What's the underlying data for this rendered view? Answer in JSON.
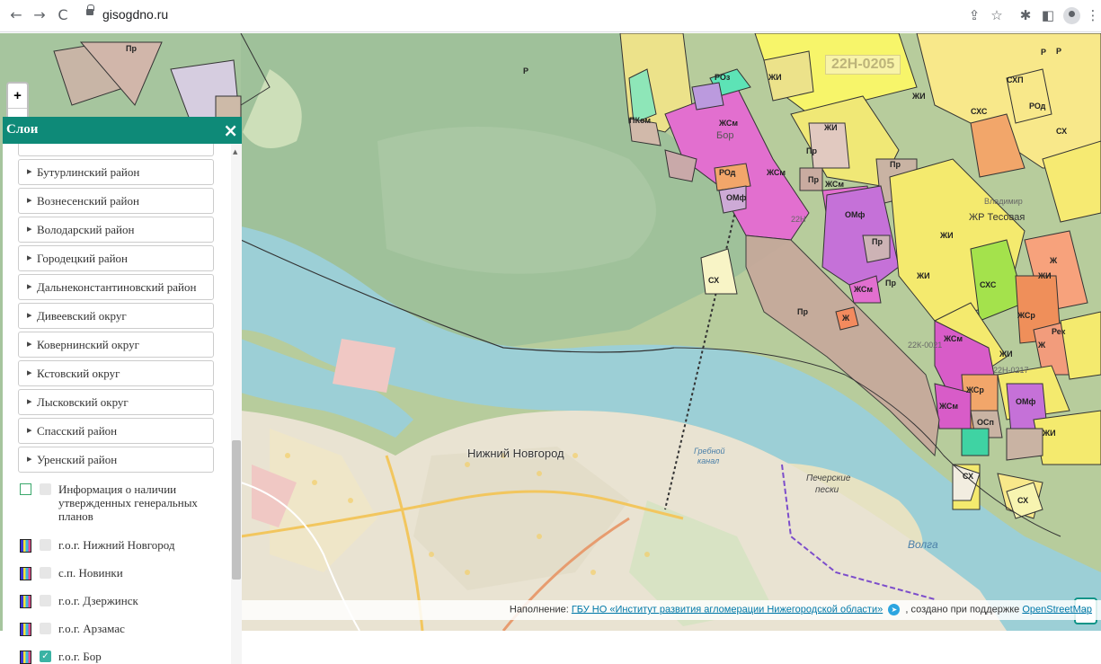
{
  "browser": {
    "url": "gisogdno.ru",
    "back": "←",
    "forward": "→",
    "reload": "C"
  },
  "map": {
    "zoom_in": "+",
    "zoom_out": "-",
    "chat_icon": "chat-icon",
    "attribution": {
      "prefix": "Наполнение:",
      "link": "ГБУ НО «Институт развития агломерации Нижегородской области»",
      "middle": ", создано при поддержке",
      "osm": "OpenStreetMap"
    },
    "labels": {
      "city": "Нижний Новгород",
      "pecherskie": "Печерские",
      "peski": "пески",
      "volga": "Волга",
      "grebnoy": "Гребной",
      "kanal": "канал",
      "bor": "Бор",
      "zr_tesovaya": "ЖР Тесовая",
      "road": "22Н-0205"
    },
    "zones": [
      "Пр",
      "ПКом",
      "Р",
      "ЖИ",
      "ЖСм",
      "РОз",
      "РОд",
      "ОМф",
      "СХ",
      "СХП",
      "СХС",
      "Ж",
      "ЖСр",
      "ОСп",
      "Рек"
    ]
  },
  "layers": {
    "title": "Слои",
    "close": "×",
    "districts": [
      "Бутурлинский район",
      "Вознесенский район",
      "Володарский район",
      "Городецкий район",
      "Дальнеконстантиновский район",
      "Дивеевский округ",
      "Ковернинский округ",
      "Кстовский округ",
      "Лысковский округ",
      "Спасский район",
      "Уренский район"
    ],
    "info": "Информация о наличии утвержденных генеральных планов",
    "plans": [
      {
        "label": "г.о.г. Нижний Новгород",
        "checked": false
      },
      {
        "label": "с.п. Новинки",
        "checked": false
      },
      {
        "label": "г.о.г. Дзержинск",
        "checked": false
      },
      {
        "label": "г.о.г. Арзамас",
        "checked": false
      },
      {
        "label": "г.о.г. Бор",
        "checked": true
      }
    ]
  }
}
